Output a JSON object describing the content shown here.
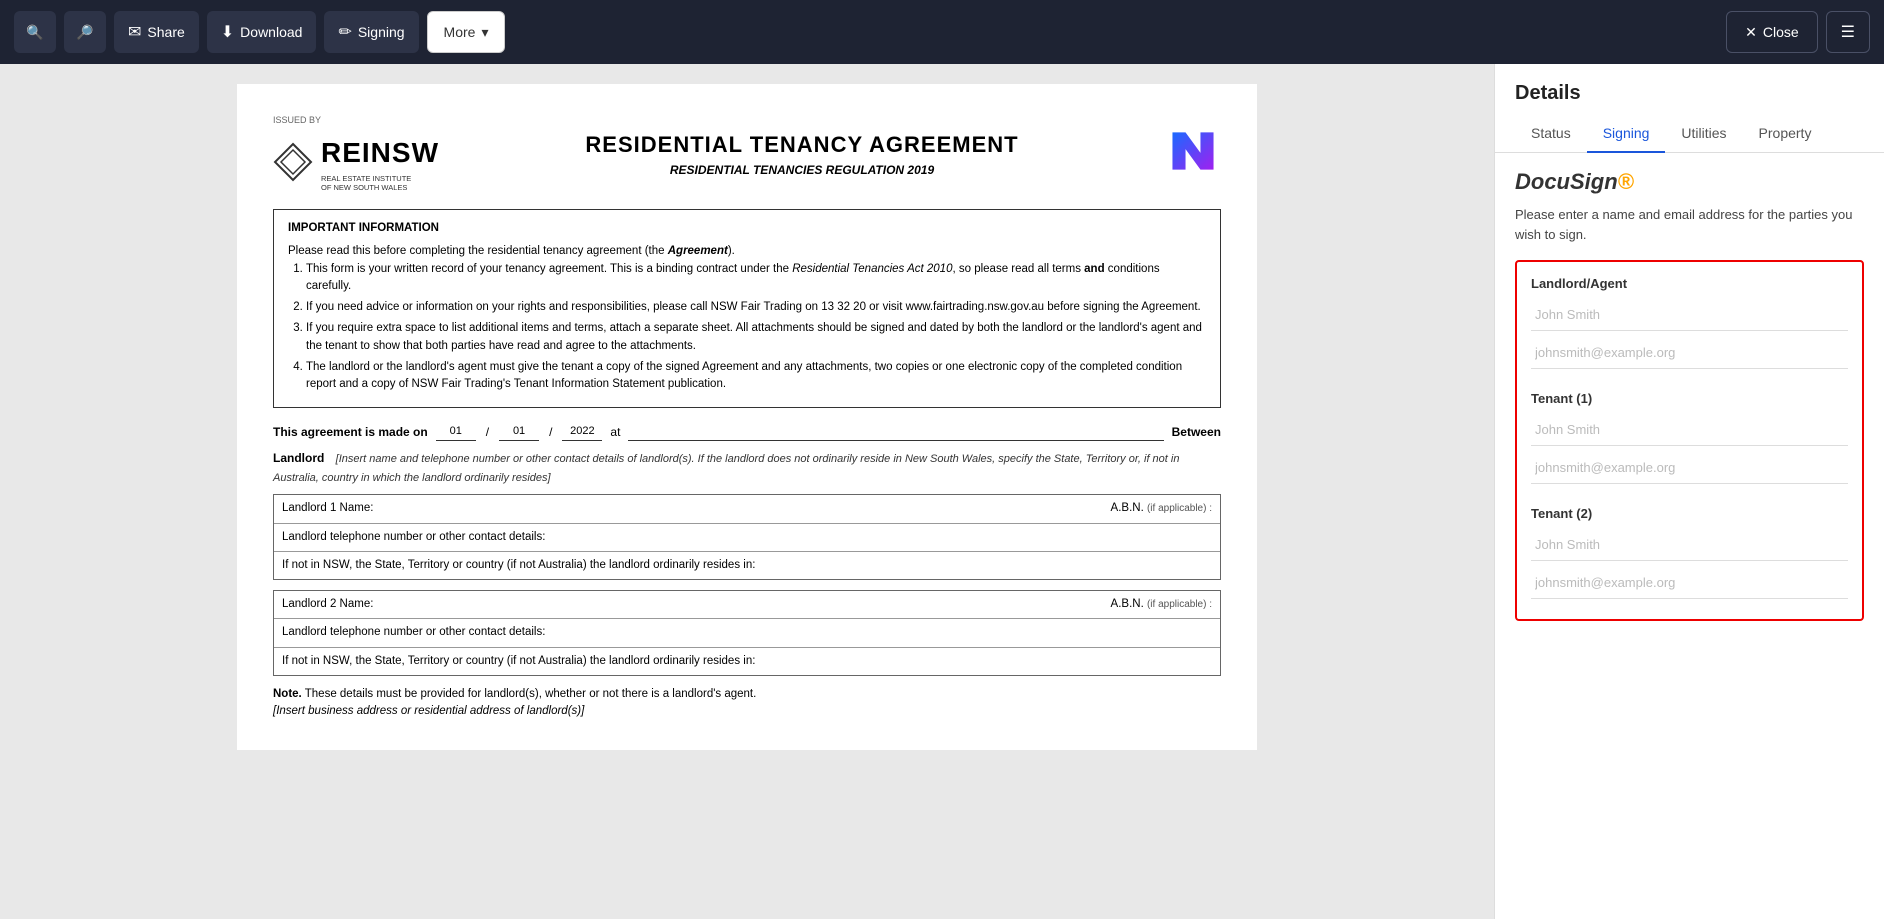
{
  "toolbar": {
    "search_icon_1": "🔍",
    "search_icon_2": "🔎",
    "share_label": "Share",
    "share_icon": "✉",
    "download_label": "Download",
    "download_icon": "⬇",
    "signing_label": "Signing",
    "signing_icon": "✏",
    "more_label": "More",
    "more_chevron": "▾",
    "close_label": "Close",
    "close_icon": "✕",
    "menu_icon": "☰"
  },
  "right_panel": {
    "header_title": "Details",
    "tabs": [
      {
        "label": "Status",
        "active": false
      },
      {
        "label": "Signing",
        "active": true
      },
      {
        "label": "Utilities",
        "active": false
      },
      {
        "label": "Property",
        "active": false
      }
    ],
    "docusign_title": "DocuSign",
    "docusign_trademark": "®",
    "description": "Please enter a name and email address for the parties you wish to sign.",
    "parties": [
      {
        "label": "Landlord/Agent",
        "name_placeholder": "John Smith",
        "email_placeholder": "johnsmith@example.org"
      },
      {
        "label": "Tenant (1)",
        "name_placeholder": "John Smith",
        "email_placeholder": "johnsmith@example.org"
      },
      {
        "label": "Tenant (2)",
        "name_placeholder": "John Smith",
        "email_placeholder": "johnsmith@example.org"
      }
    ]
  },
  "document": {
    "issued_by": "ISSUED BY",
    "reinsw_name": "REINSW",
    "reinsw_subtitle": "REAL ESTATE INSTITUTE\nOF NEW SOUTH WALES",
    "doc_title": "RESIDENTIAL TENANCY AGREEMENT",
    "doc_subtitle": "RESIDENTIAL TENANCIES REGULATION 2019",
    "info_title": "IMPORTANT INFORMATION",
    "info_intro": "Please read this before completing the residential tenancy agreement (the Agreement).",
    "info_items": [
      "This form is your written record of your tenancy agreement. This is a binding contract under the Residential Tenancies Act 2010, so please read all terms and conditions carefully.",
      "If you need advice or information on your rights and responsibilities, please call NSW Fair Trading on 13 32 20 or visit www.fairtrading.nsw.gov.au before signing the Agreement.",
      "If you require extra space to list additional items and terms, attach a separate sheet. All attachments should be signed and dated by both the landlord or the landlord's agent and the tenant to show that both parties have read and agree to the attachments.",
      "The landlord or the landlord's agent must give the tenant a copy of the signed Agreement and any attachments, two copies or one electronic copy of the completed condition report and a copy of NSW Fair Trading's Tenant Information Statement publication."
    ],
    "agreement_made_on": "This agreement is made on",
    "date_day": "01",
    "date_month": "01",
    "date_year": "2022",
    "at_label": "at",
    "between_label": "Between",
    "landlord_label": "Landlord",
    "landlord_instruction": "[Insert name and telephone number or other contact details of landlord(s). If the landlord does not ordinarily reside in New South Wales, specify the State, Territory or, if not in Australia, country in which the landlord ordinarily resides]",
    "landlord1_name_label": "Landlord 1   Name:",
    "landlord1_abn_label": "A.B.N.",
    "landlord1_abn_note": "if applicable :",
    "landlord1_phone_label": "Landlord telephone number or other contact details:",
    "landlord1_state_label": "If not in NSW, the State, Territory or country (if not Australia) the landlord ordinarily resides in:",
    "landlord2_name_label": "Landlord 2   Name:",
    "landlord2_abn_label": "A.B.N.",
    "landlord2_abn_note": "if applicable :",
    "landlord2_phone_label": "Landlord telephone number or other contact details:",
    "landlord2_state_label": "If not in NSW, the State, Territory or country (if not Australia) the landlord ordinarily resides in:",
    "note_label": "Note.",
    "note_text": "These details must be provided for landlord(s), whether or not there is a landlord's agent.",
    "note_italic": "[Insert business address or residential address of landlord(s)]"
  }
}
